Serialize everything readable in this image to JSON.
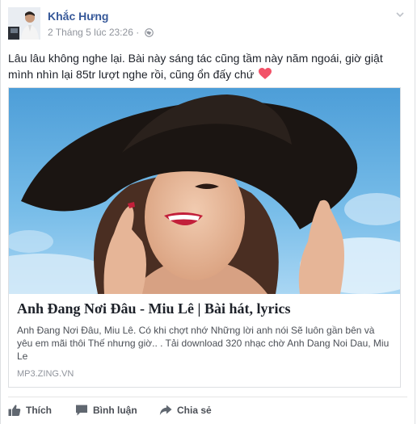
{
  "post": {
    "author": "Khắc Hưng",
    "timestamp": "2 Tháng 5 lúc 23:26",
    "audience_icon": "globe-icon",
    "message": "Lâu lâu không nghe lại. Bài này sáng tác cũng tầm này năm ngoái, giờ giật mình nhìn lại 85tr lượt nghe rồi, cũng ổn đấy chứ",
    "message_emoji": "heart-icon"
  },
  "link_card": {
    "title": "Anh Đang Nơi Đâu - Miu Lê | Bài hát, lyrics",
    "description": "Anh Đang Nơi Đâu, Miu Lê. Có khi chợt nhớ Những lời anh nói Sẽ luôn gần bên và yêu em mãi thôi Thế nhưng giờ.. . Tải download 320 nhạc chờ Anh Dang Noi Dau, Miu Le",
    "domain": "MP3.ZING.VN"
  },
  "actions": {
    "like_label": "Thích",
    "comment_label": "Bình luận",
    "share_label": "Chia sẻ"
  },
  "colors": {
    "author_link": "#365899",
    "meta_gray": "#90949c",
    "heart": "#f25268",
    "sky": "#5aa9de"
  }
}
